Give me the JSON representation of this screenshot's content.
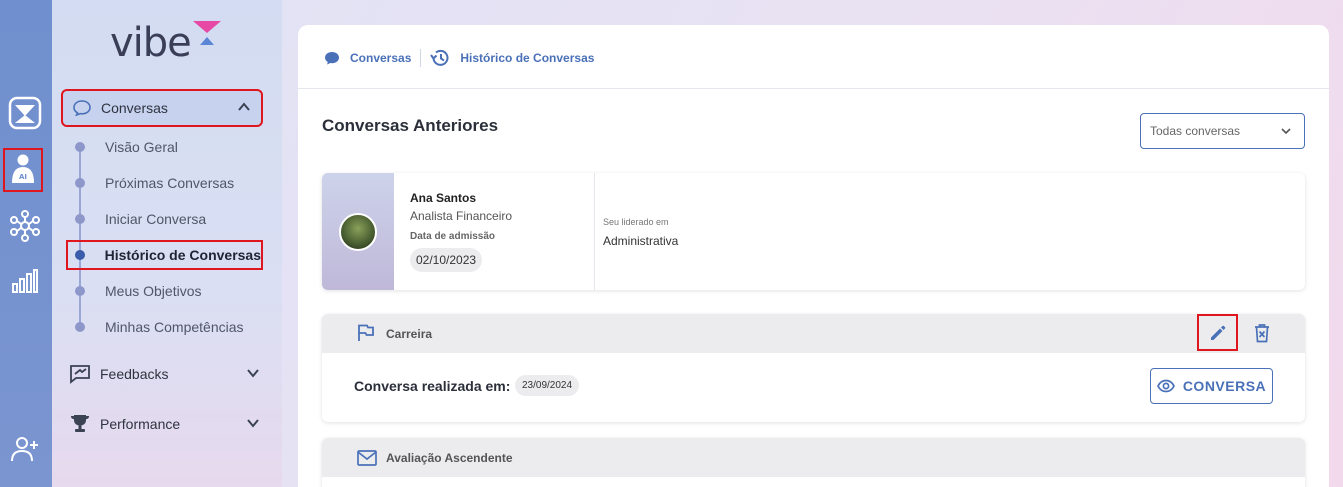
{
  "app": {
    "logo_text": "vibe"
  },
  "sidebar": {
    "groups": [
      {
        "label": "Conversas"
      },
      {
        "label": "Feedbacks"
      },
      {
        "label": "Performance"
      }
    ],
    "sub_items": [
      {
        "label": "Visão Geral"
      },
      {
        "label": "Próximas Conversas"
      },
      {
        "label": "Iniciar Conversa"
      },
      {
        "label": "Histórico de Conversas"
      },
      {
        "label": "Meus Objetivos"
      },
      {
        "label": "Minhas Competências"
      }
    ]
  },
  "rail": {
    "ai_badge": "AI"
  },
  "breadcrumb": {
    "item1": "Conversas",
    "item2": "Histórico de Conversas"
  },
  "page": {
    "title": "Conversas Anteriores",
    "filter": {
      "selected": "Todas conversas"
    }
  },
  "profile": {
    "name": "Ana Santos",
    "role": "Analista Financeiro",
    "admission_label": "Data de admissão",
    "admission_date": "02/10/2023",
    "led_label": "Seu liderado em",
    "led_value": "Administrativa"
  },
  "cards": [
    {
      "title": "Carreira",
      "conversation_label": "Conversa realizada em:",
      "conversation_date": "23/09/2024",
      "button_label": "CONVERSA"
    },
    {
      "title": "Avaliação Ascendente"
    }
  ],
  "colors": {
    "accent": "#4a71b8",
    "rail": "#7390cf",
    "highlight": "#e0161e"
  }
}
